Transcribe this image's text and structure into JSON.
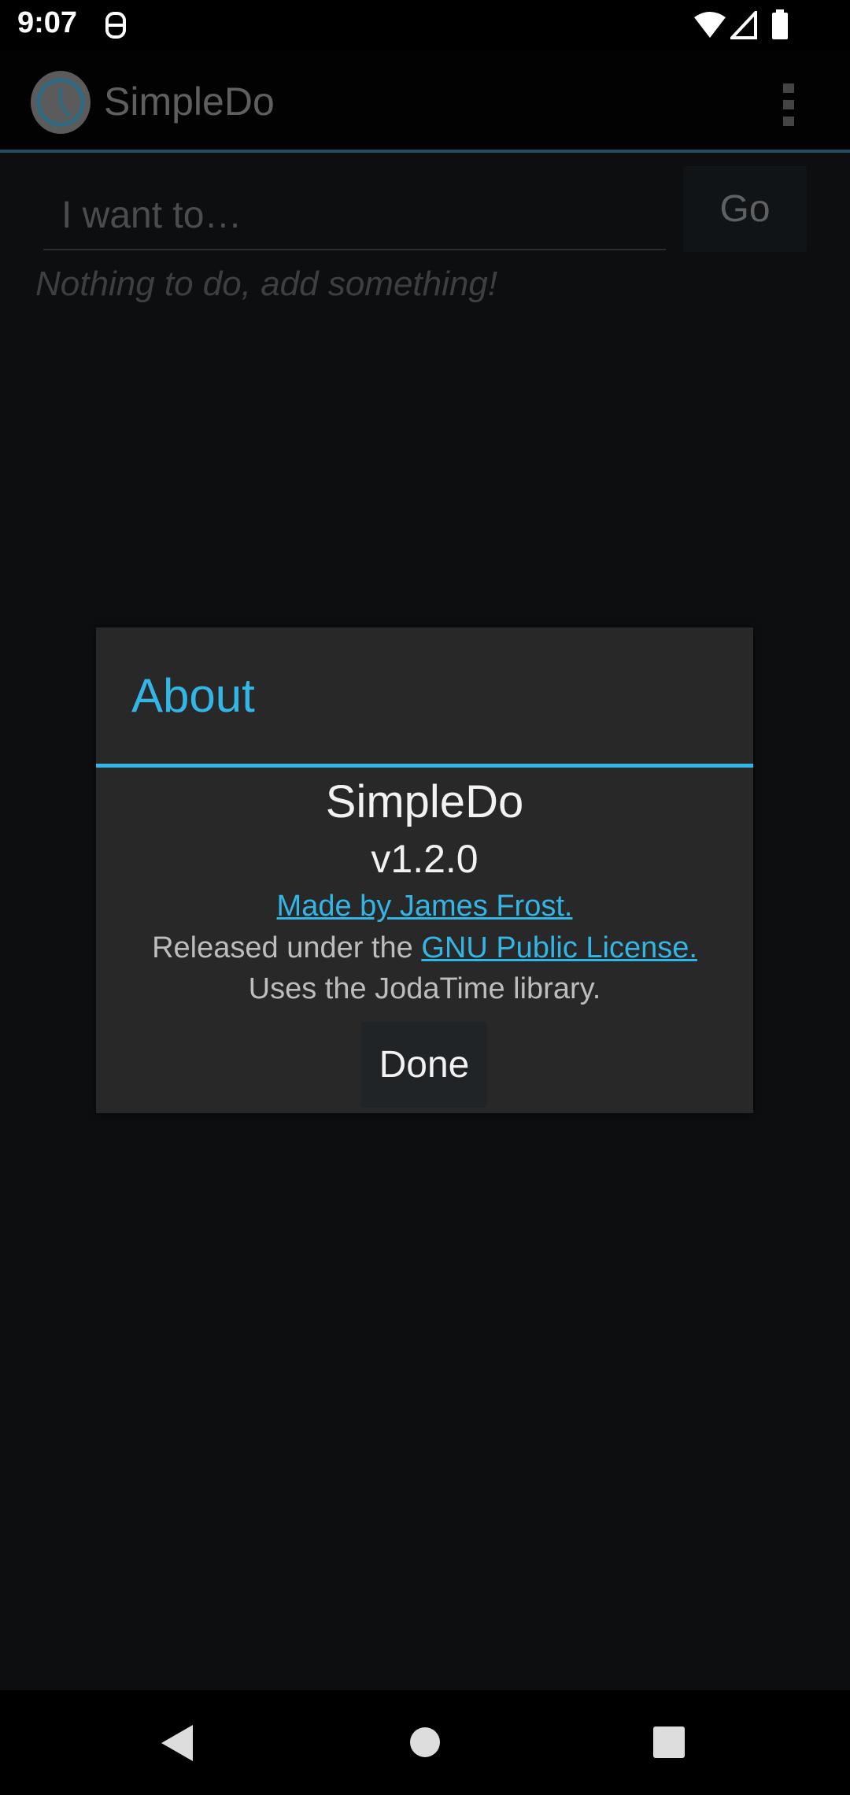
{
  "status_bar": {
    "time": "9:07"
  },
  "app_bar": {
    "title": "SimpleDo",
    "icon": "clock-icon",
    "menu_icon": "more-vert-icon"
  },
  "main": {
    "input_placeholder": "I want to…",
    "go_label": "Go",
    "empty_text": "Nothing to do, add something!"
  },
  "dialog": {
    "title": "About",
    "app_name": "SimpleDo",
    "version": "v1.2.0",
    "made_by": "Made by James Frost.",
    "released_prefix": "Released under the ",
    "license_link": "GNU Public License.",
    "uses": "Uses the JodaTime library.",
    "done_label": "Done"
  },
  "colors": {
    "accent": "#33b5e5",
    "dialog_bg": "#282828"
  }
}
